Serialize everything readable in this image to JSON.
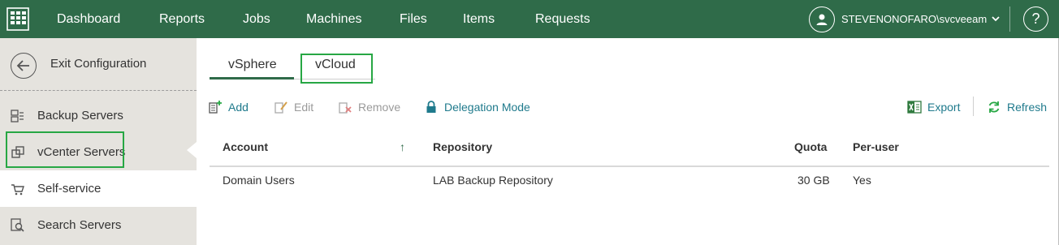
{
  "nav": {
    "items": [
      "Dashboard",
      "Reports",
      "Jobs",
      "Machines",
      "Files",
      "Items",
      "Requests"
    ],
    "user": "STEVENONOFARO\\svcveeam",
    "help": "?"
  },
  "sidebar": {
    "exit_label": "Exit Configuration",
    "items": [
      {
        "label": "Backup Servers",
        "icon": "backup-servers-icon"
      },
      {
        "label": "vCenter Servers",
        "icon": "vcenter-servers-icon"
      },
      {
        "label": "Self-service",
        "icon": "cart-icon",
        "active": true
      },
      {
        "label": "Search Servers",
        "icon": "search-servers-icon"
      }
    ]
  },
  "tabs": [
    "vSphere",
    "vCloud"
  ],
  "toolbar": {
    "add": "Add",
    "edit": "Edit",
    "remove": "Remove",
    "delegation": "Delegation Mode",
    "export": "Export",
    "refresh": "Refresh"
  },
  "table": {
    "columns": [
      "Account",
      "Repository",
      "Quota",
      "Per-user"
    ],
    "sort_indicator": "↑",
    "rows": [
      {
        "account": "Domain Users",
        "repository": "LAB Backup Repository",
        "quota": "30 GB",
        "per_user": "Yes"
      }
    ]
  },
  "colors": {
    "topbar": "#2f6b49",
    "sidebar": "#e5e3de",
    "accent_link": "#1f7a8c",
    "highlight": "#27a744"
  }
}
